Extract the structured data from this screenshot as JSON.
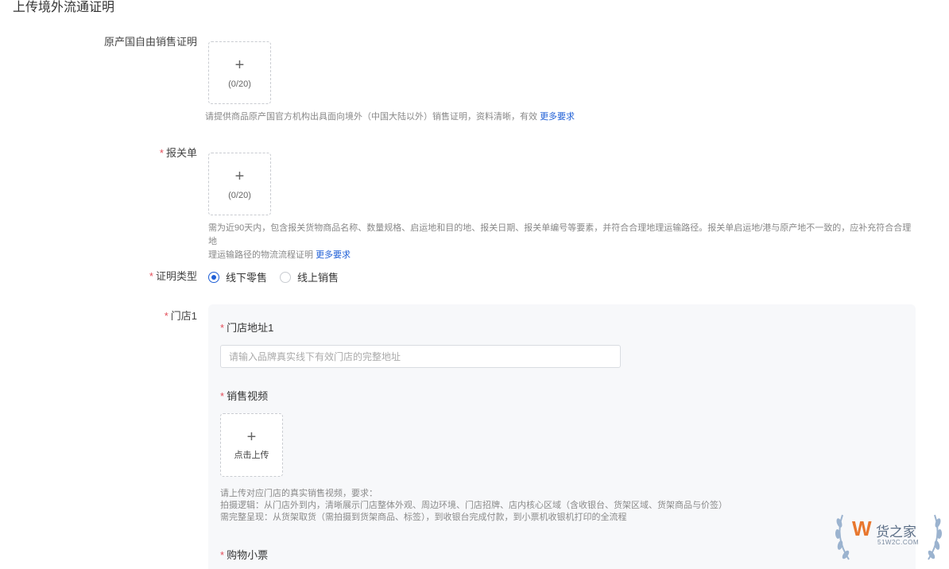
{
  "page": {
    "section_title": "上传境外流通证明"
  },
  "free_sale": {
    "label": "原产国自由销售证明",
    "upload_plus": "+",
    "upload_count": "(0/20)",
    "hint": "请提供商品原产国官方机构出具面向境外（中国大陆以外）销售证明，资料清晰，有效",
    "hint_link": "更多要求"
  },
  "customs": {
    "required_mark": "*",
    "label": "报关单",
    "upload_plus": "+",
    "upload_count": "(0/20)",
    "hint_line1": "需为近90天内，包含报关货物商品名称、数量规格、启运地和目的地、报关日期、报关单编号等要素，并符合合理地理运输路径。报关单启运地/港与原产地不一致的，应补充符合合理地",
    "hint_line2": "理运输路径的物流流程证明",
    "hint_link": "更多要求"
  },
  "proof_type": {
    "required_mark": "*",
    "label": "证明类型",
    "options": [
      {
        "label": "线下零售",
        "checked": true
      },
      {
        "label": "线上销售",
        "checked": false
      }
    ]
  },
  "store": {
    "required_mark": "*",
    "label": "门店1",
    "address": {
      "required_mark": "*",
      "label": "门店地址1",
      "placeholder": "请输入品牌真实线下有效门店的完整地址",
      "value": ""
    },
    "video": {
      "required_mark": "*",
      "label": "销售视频",
      "upload_plus": "+",
      "upload_text": "点击上传",
      "hint_line1": "请上传对应门店的真实销售视频，要求：",
      "hint_line2": "拍摄逻辑：从门店外到内，清晰展示门店整体外观、周边环境、门店招牌、店内核心区域（含收银台、货架区域、货架商品与价签）",
      "hint_line3": "需完整呈现：从货架取货（需拍摄到货架商品、标签），到收银台完成付款，到小票机收银机打印的全流程"
    },
    "receipt": {
      "required_mark": "*",
      "label": "购物小票"
    }
  },
  "watermark": {
    "logo_letter": "W",
    "brand": "货之家",
    "domain": "51W2C.COM",
    "accent_color": "#e8772e",
    "laurel_color": "#9bb3cf"
  }
}
